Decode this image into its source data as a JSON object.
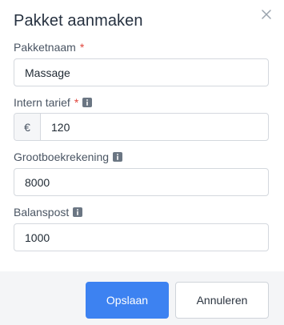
{
  "modal": {
    "title": "Pakket aanmaken",
    "close_icon": "close-icon"
  },
  "fields": {
    "name": {
      "label": "Pakketnaam",
      "required_mark": "*",
      "value": "Massage"
    },
    "internal_rate": {
      "label": "Intern tarief",
      "required_mark": "*",
      "info_icon": "info-icon",
      "currency_symbol": "€",
      "value": "120"
    },
    "ledger": {
      "label": "Grootboekrekening",
      "info_icon": "info-icon",
      "value": "8000"
    },
    "balance": {
      "label": "Balanspost",
      "info_icon": "info-icon",
      "value": "1000"
    }
  },
  "footer": {
    "save_label": "Opslaan",
    "cancel_label": "Annuleren"
  },
  "colors": {
    "primary": "#3d82f1",
    "required": "#e0453c",
    "footer_bg": "#f4f5f7"
  }
}
